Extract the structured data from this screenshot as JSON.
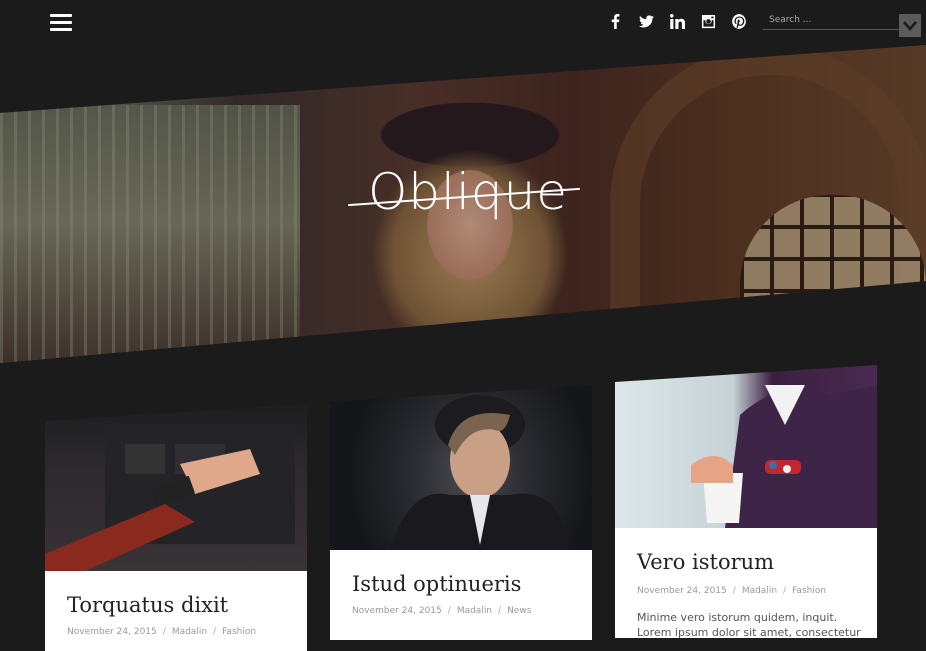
{
  "site": {
    "logo_text": "Oblique"
  },
  "header": {
    "social": [
      "facebook-icon",
      "twitter-icon",
      "linkedin-icon",
      "instagram-icon",
      "pinterest-icon"
    ],
    "search_placeholder": "Search ..."
  },
  "posts": [
    {
      "title": "Torquatus dixit",
      "date": "November 24, 2015",
      "author": "Madalin",
      "category": "Fashion",
      "excerpt": ""
    },
    {
      "title": "Istud optinueris",
      "date": "November 24, 2015",
      "author": "Madalin",
      "category": "News",
      "excerpt": ""
    },
    {
      "title": "Vero istorum",
      "date": "November 24, 2015",
      "author": "Madalin",
      "category": "Fashion",
      "excerpt": "Minime vero istorum quidem, inquit. Lorem ipsum dolor sit amet, consectetur"
    }
  ],
  "colors": {
    "background": "#1b1b1b",
    "card": "#ffffff",
    "search_button": "#5b5b5b"
  }
}
